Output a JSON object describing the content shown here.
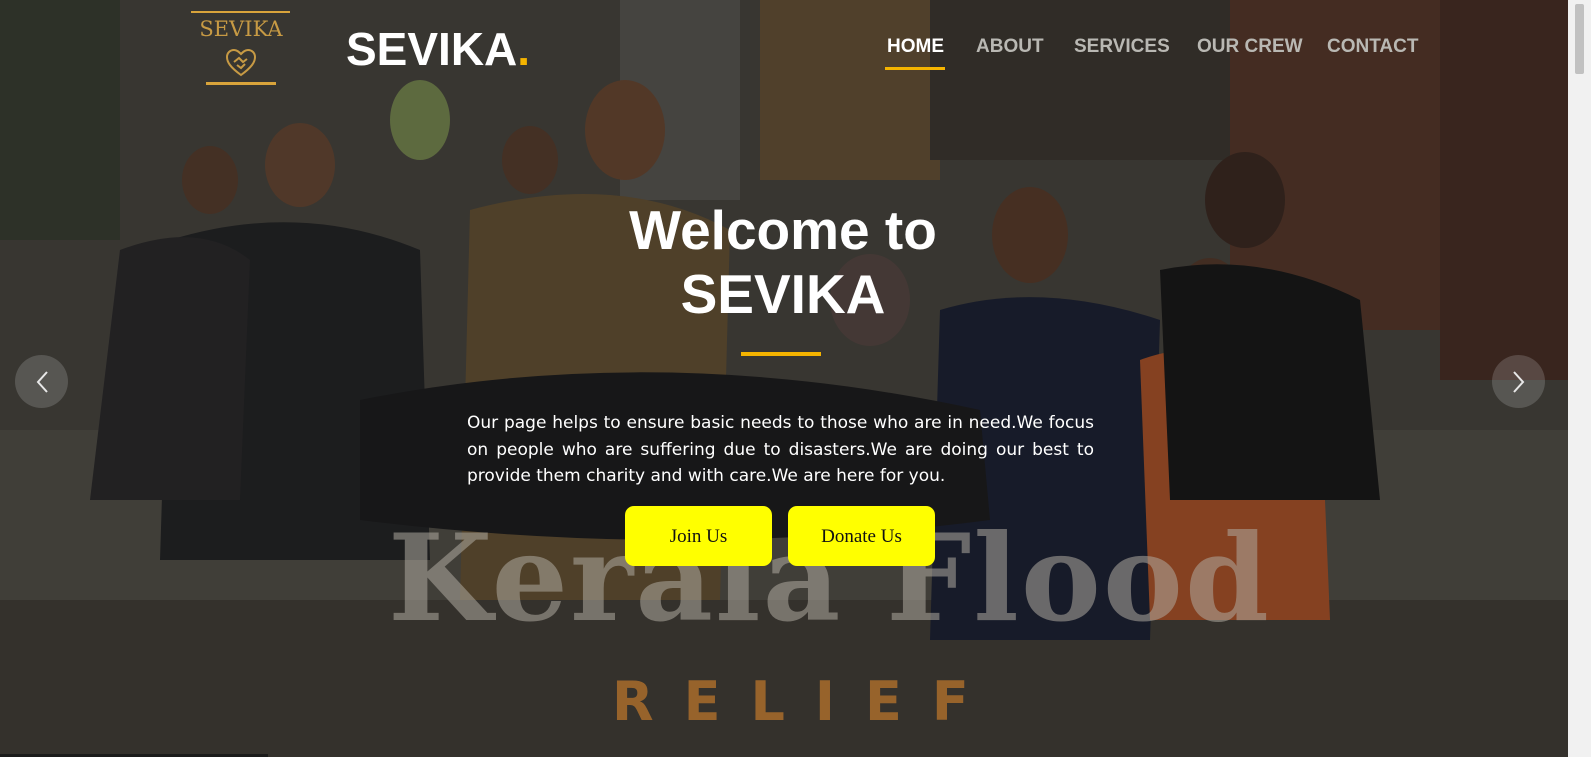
{
  "header": {
    "logo_badge_text": "SEVIKA",
    "brand_name": "SEVIKA",
    "brand_dot": "."
  },
  "nav": {
    "items": [
      {
        "label": "HOME",
        "active": true
      },
      {
        "label": "ABOUT",
        "active": false
      },
      {
        "label": "SERVICES",
        "active": false
      },
      {
        "label": "OUR CREW",
        "active": false
      },
      {
        "label": "CONTACT",
        "active": false
      }
    ]
  },
  "hero": {
    "title_line1": "Welcome to",
    "title_line2": "SEVIKA",
    "lead": "Our page helps to ensure basic needs to those who are in need.We focus on people who are suffering due to disasters.We are doing our best to provide them charity and with care.We are here for you.",
    "join_label": "Join Us",
    "donate_label": "Donate Us",
    "image_caption_main": "Kerala Flood",
    "image_caption_sub": "RELIEF"
  },
  "carousel": {
    "prev_icon": "chevron-left-icon",
    "next_icon": "chevron-right-icon"
  },
  "colors": {
    "accent": "#f5b400",
    "button_bg": "#ffff00",
    "nav_active": "#ffffff",
    "nav_inactive": "#b9b8b3",
    "logo_gold": "#c79a44"
  }
}
